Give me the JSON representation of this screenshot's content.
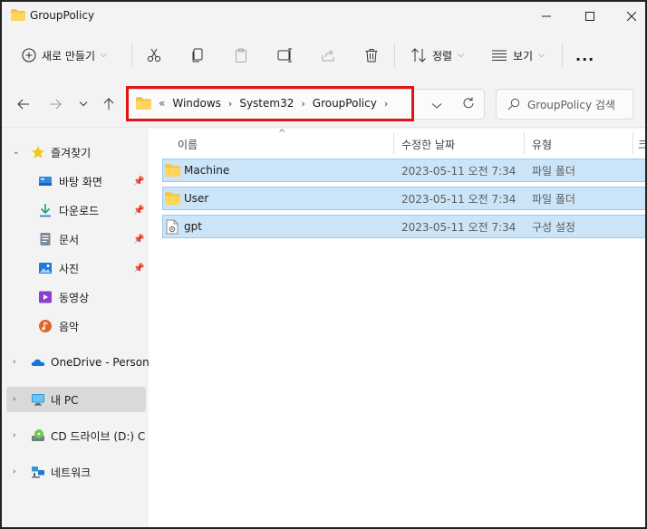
{
  "window": {
    "title": "GroupPolicy",
    "controls": [
      "minimize",
      "maximize",
      "close"
    ]
  },
  "toolbar": {
    "new_label": "새로 만들기",
    "sort_label": "정렬",
    "view_label": "보기",
    "more_label": "...",
    "icons": [
      "cut-icon",
      "copy-icon",
      "paste-icon",
      "rename-icon",
      "share-icon",
      "delete-icon"
    ]
  },
  "address": {
    "overflow": "«",
    "crumbs": [
      "Windows",
      "System32",
      "GroupPolicy"
    ],
    "highlight_color": "#e01414"
  },
  "search": {
    "placeholder": "GroupPolicy 검색"
  },
  "sidebar": {
    "quick_access": "즐겨찾기",
    "items": [
      {
        "label": "바탕 화면",
        "icon": "desktop-icon",
        "pinned": true
      },
      {
        "label": "다운로드",
        "icon": "download-icon",
        "pinned": true
      },
      {
        "label": "문서",
        "icon": "document-icon",
        "pinned": true
      },
      {
        "label": "사진",
        "icon": "pictures-icon",
        "pinned": true
      },
      {
        "label": "동영상",
        "icon": "video-icon",
        "pinned": false
      },
      {
        "label": "음악",
        "icon": "music-icon",
        "pinned": false
      }
    ],
    "onedrive": "OneDrive - Persona",
    "this_pc": "내 PC",
    "cd_drive": "CD 드라이브 (D:) C",
    "network": "네트워크"
  },
  "columns": {
    "name": "이름",
    "modified": "수정한 날짜",
    "type": "유형",
    "size": "크"
  },
  "files": [
    {
      "name": "Machine",
      "modified": "2023-05-11 오전 7:34",
      "type": "파일 폴더",
      "icon": "folder-icon"
    },
    {
      "name": "User",
      "modified": "2023-05-11 오전 7:34",
      "type": "파일 폴더",
      "icon": "folder-icon"
    },
    {
      "name": "gpt",
      "modified": "2023-05-11 오전 7:34",
      "type": "구성 설정",
      "icon": "config-file-icon"
    }
  ],
  "colors": {
    "selection_bg": "#cce4f7",
    "selection_border": "#99c9ef",
    "folder": "#f4c443"
  }
}
